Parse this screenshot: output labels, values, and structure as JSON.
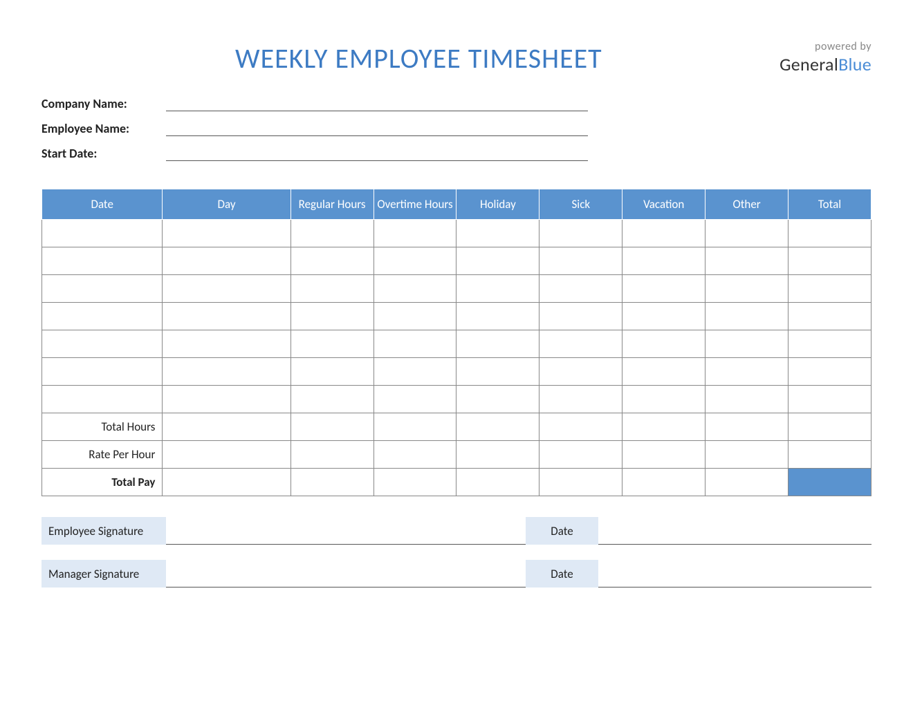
{
  "title": "WEEKLY EMPLOYEE TIMESHEET",
  "brand": {
    "powered": "powered by",
    "name1": "General",
    "name2": "Blue"
  },
  "info": {
    "company_label": "Company Name:",
    "employee_label": "Employee Name:",
    "start_date_label": "Start Date:",
    "company_value": "",
    "employee_value": "",
    "start_date_value": ""
  },
  "columns": [
    "Date",
    "Day",
    "Regular Hours",
    "Overtime Hours",
    "Holiday",
    "Sick",
    "Vacation",
    "Other",
    "Total"
  ],
  "rows": [
    {
      "date": "",
      "day": "",
      "regular": "",
      "overtime": "",
      "holiday": "",
      "sick": "",
      "vacation": "",
      "other": "",
      "total": ""
    },
    {
      "date": "",
      "day": "",
      "regular": "",
      "overtime": "",
      "holiday": "",
      "sick": "",
      "vacation": "",
      "other": "",
      "total": ""
    },
    {
      "date": "",
      "day": "",
      "regular": "",
      "overtime": "",
      "holiday": "",
      "sick": "",
      "vacation": "",
      "other": "",
      "total": ""
    },
    {
      "date": "",
      "day": "",
      "regular": "",
      "overtime": "",
      "holiday": "",
      "sick": "",
      "vacation": "",
      "other": "",
      "total": ""
    },
    {
      "date": "",
      "day": "",
      "regular": "",
      "overtime": "",
      "holiday": "",
      "sick": "",
      "vacation": "",
      "other": "",
      "total": ""
    },
    {
      "date": "",
      "day": "",
      "regular": "",
      "overtime": "",
      "holiday": "",
      "sick": "",
      "vacation": "",
      "other": "",
      "total": ""
    },
    {
      "date": "",
      "day": "",
      "regular": "",
      "overtime": "",
      "holiday": "",
      "sick": "",
      "vacation": "",
      "other": "",
      "total": ""
    }
  ],
  "summary": {
    "total_hours_label": "Total Hours",
    "rate_label": "Rate Per Hour",
    "total_pay_label": "Total Pay"
  },
  "signatures": {
    "employee_label": "Employee Signature",
    "manager_label": "Manager Signature",
    "date_label": "Date"
  }
}
